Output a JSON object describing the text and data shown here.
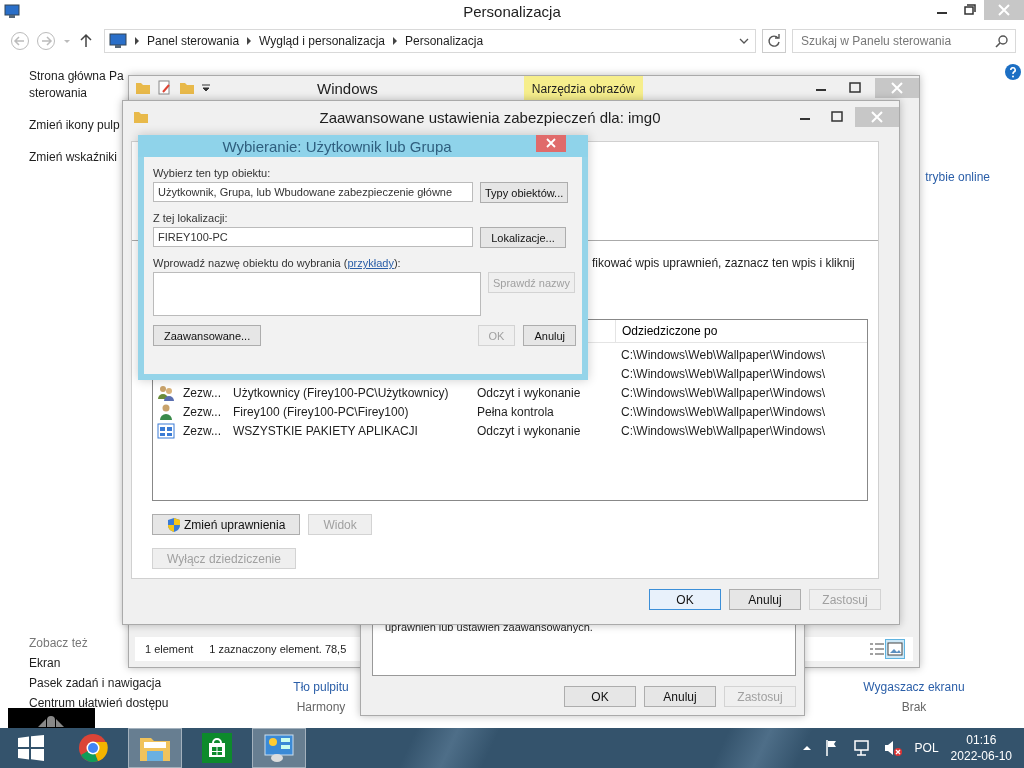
{
  "cp_window": {
    "title": "Personalizacja",
    "breadcrumb": [
      "Panel sterowania",
      "Wygląd i personalizacja",
      "Personalizacja"
    ],
    "search": {
      "placeholder": "Szukaj w Panelu sterowania"
    },
    "sidebar_links": [
      [
        "Strona główna Pa",
        "sterowania"
      ],
      [
        "Zmień ikony pulp"
      ],
      [
        "Zmień wskaźniki"
      ]
    ],
    "see_also": {
      "heading": "Zobacz też",
      "links": [
        "Ekran",
        "Pasek zadań i nawigacja",
        "Centrum ułatwień dostępu"
      ]
    },
    "online_link": "trybie online",
    "bottom_items": [
      {
        "title": "Tło pulpitu",
        "value": "Harmony"
      },
      {
        "title": "Wygaszacz ekranu",
        "value": "Brak"
      }
    ]
  },
  "explorer": {
    "title": "Windows",
    "ribbon_tab": "Narzędzia obrazów",
    "status": [
      "1 element",
      "1 zaznaczony element. 78,5"
    ],
    "view_buttons": [
      {
        "kind": "details",
        "selected": false
      },
      {
        "kind": "thumbnails",
        "selected": true
      }
    ]
  },
  "properties": {
    "note": "uprawnień lub ustawień zaawansowanych.",
    "buttons": [
      {
        "label": "OK",
        "disabled": false
      },
      {
        "label": "Anuluj",
        "disabled": false
      },
      {
        "label": "Zastosuj",
        "disabled": true
      }
    ]
  },
  "advanced": {
    "title": "Zaawansowane ustawienia zabezpieczeń dla: img0",
    "info": "fikować wpis uprawnień, zaznacz ten wpis i kliknij",
    "inherited_header": "Odziedziczone po",
    "rows": [
      {
        "inherited": "C:\\Windows\\Web\\Wallpaper\\Windows\\"
      },
      {
        "inherited": "C:\\Windows\\Web\\Wallpaper\\Windows\\"
      },
      {
        "kind": "group",
        "type": "Zezw...",
        "principal": "Użytkownicy (Firey100-PC\\Użytkownicy)",
        "access": "Odczyt i wykonanie",
        "inherited": "C:\\Windows\\Web\\Wallpaper\\Windows\\"
      },
      {
        "kind": "user",
        "type": "Zezw...",
        "principal": "Firey100 (Firey100-PC\\Firey100)",
        "access": "Pełna kontrola",
        "inherited": "C:\\Windows\\Web\\Wallpaper\\Windows\\"
      },
      {
        "kind": "packages",
        "type": "Zezw...",
        "principal": "WSZYSTKIE PAKIETY APLIKACJI",
        "access": "Odczyt i wykonanie",
        "inherited": "C:\\Windows\\Web\\Wallpaper\\Windows\\"
      }
    ],
    "actions": [
      {
        "label": "Zmień uprawnienia",
        "shield": true,
        "disabled": false
      },
      {
        "label": "Widok",
        "shield": false,
        "disabled": true
      }
    ],
    "inheritance_button": {
      "label": "Wyłącz dziedziczenie",
      "disabled": true
    },
    "buttons": [
      {
        "label": "OK",
        "disabled": false,
        "default": true
      },
      {
        "label": "Anuluj",
        "disabled": false,
        "default": false
      },
      {
        "label": "Zastosuj",
        "disabled": true,
        "default": false
      }
    ]
  },
  "picker": {
    "title": "Wybieranie: Użytkownik lub Grupa",
    "type_label": "Wybierz ten typ obiektu:",
    "type_value": "Użytkownik, Grupa, lub Wbudowane zabezpieczenie główne",
    "type_button": "Typy obiektów...",
    "location_label": "Z tej lokalizacji:",
    "location_value": "FIREY100-PC",
    "location_button": "Lokalizacje...",
    "name_label": "Wprowadź nazwę obiektu do wybrania (",
    "name_link": "przykłady",
    "name_label_end": "):",
    "check_button": {
      "label": "Sprawdź nazwy",
      "disabled": true
    },
    "buttons": [
      {
        "label": "Zaawansowane...",
        "disabled": false
      },
      {
        "label": "OK",
        "disabled": true
      },
      {
        "label": "Anuluj",
        "disabled": false
      }
    ]
  },
  "taskbar": {
    "apps": [
      {
        "kind": "start",
        "open": false
      },
      {
        "kind": "browser",
        "open": false
      },
      {
        "kind": "folder",
        "open": true
      },
      {
        "kind": "store",
        "open": false
      },
      {
        "kind": "control-panel",
        "open": true
      }
    ],
    "language": "POL",
    "time": "01:16",
    "date": "2022-06-10"
  }
}
